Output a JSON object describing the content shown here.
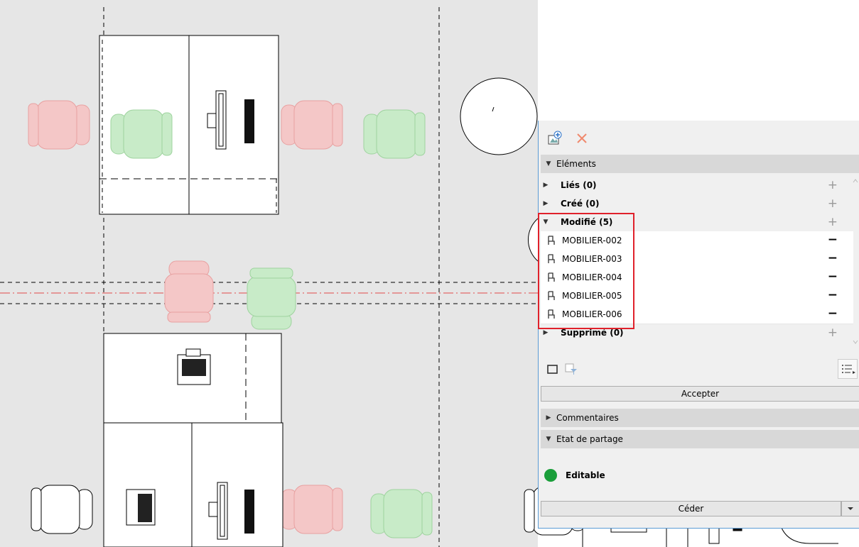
{
  "toolbar": {
    "add_icon": "add-layer-icon",
    "close_icon": "close-icon"
  },
  "sections": {
    "elements": "Eléments",
    "comments": "Commentaires",
    "sharing": "Etat de partage"
  },
  "groups": {
    "linked": "Liés (0)",
    "created": "Créé (0)",
    "modified": "Modifié (5)",
    "deleted": "Supprimé (0)"
  },
  "modified_items": [
    {
      "label": "MOBILIER-002"
    },
    {
      "label": "MOBILIER-003"
    },
    {
      "label": "MOBILIER-004"
    },
    {
      "label": "MOBILIER-005"
    },
    {
      "label": "MOBILIER-006"
    }
  ],
  "actions": {
    "accept": "Accepter",
    "release": "Céder"
  },
  "status": {
    "label": "Editable",
    "color": "#1a9e3a"
  },
  "colors": {
    "highlight": "#e0212b",
    "modified_chair": "#e8a0a0",
    "new_chair": "#9ed39e",
    "canvas_bg": "#e6e6e6"
  }
}
